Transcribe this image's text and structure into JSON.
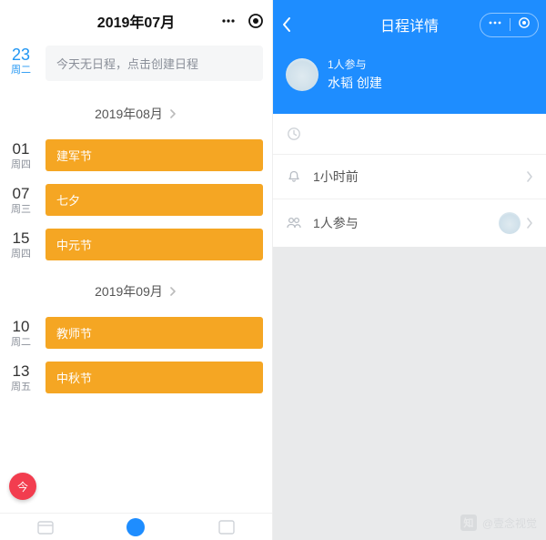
{
  "left": {
    "title": "2019年07月",
    "today": {
      "num": "23",
      "day": "周二",
      "message": "今天无日程，点击创建日程"
    },
    "months": [
      {
        "label": "2019年08月",
        "events": [
          {
            "num": "01",
            "day": "周四",
            "title": "建军节"
          },
          {
            "num": "07",
            "day": "周三",
            "title": "七夕"
          },
          {
            "num": "15",
            "day": "周四",
            "title": "中元节"
          }
        ]
      },
      {
        "label": "2019年09月",
        "events": [
          {
            "num": "10",
            "day": "周二",
            "title": "教师节"
          },
          {
            "num": "13",
            "day": "周五",
            "title": "中秋节"
          }
        ]
      }
    ],
    "fab": "今"
  },
  "right": {
    "title": "日程详情",
    "creator": {
      "participants": "1人参与",
      "name": "水韬 创建"
    },
    "rows": {
      "time_placeholder": "",
      "reminder": "1小时前",
      "participants": "1人参与"
    }
  },
  "watermark": {
    "logo": "知",
    "text": "@壹念视觉"
  }
}
